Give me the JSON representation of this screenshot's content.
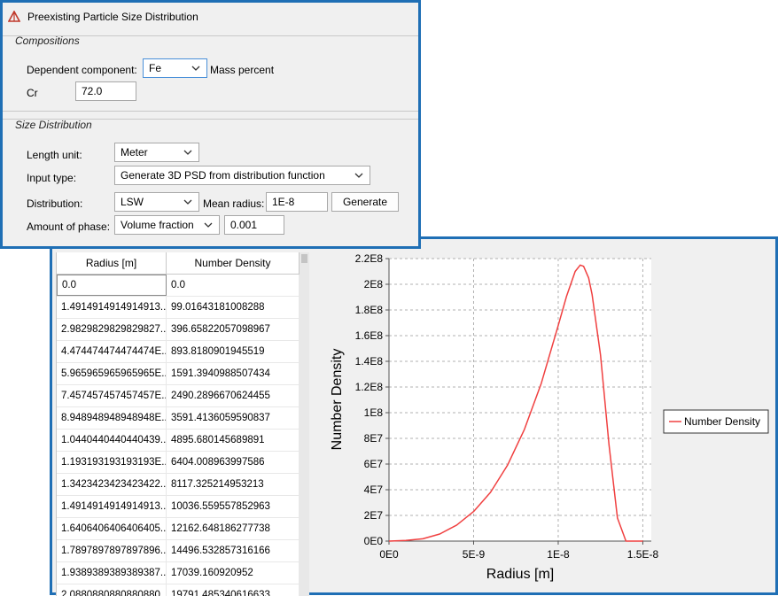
{
  "window": {
    "title": "Preexisting Particle Size Distribution"
  },
  "compositions": {
    "group_title": "Compositions",
    "dependent_label": "Dependent component:",
    "dependent_value": "Fe",
    "unit_label": "Mass percent",
    "cr_label": "Cr",
    "cr_value": "72.0"
  },
  "size_distribution": {
    "group_title": "Size Distribution",
    "length_unit_label": "Length unit:",
    "length_unit_value": "Meter",
    "input_type_label": "Input type:",
    "input_type_value": "Generate 3D PSD from distribution function",
    "distribution_label": "Distribution:",
    "distribution_value": "LSW",
    "mean_radius_label": "Mean radius:",
    "mean_radius_value": "1E-8",
    "generate_label": "Generate",
    "amount_label": "Amount of phase:",
    "amount_type_value": "Volume fraction",
    "amount_value": "0.001"
  },
  "table": {
    "headers": [
      "Radius [m]",
      "Number Density"
    ],
    "rows": [
      [
        "0.0",
        "0.0"
      ],
      [
        "1.4914914914914913...",
        "99.01643181008288"
      ],
      [
        "2.9829829829829827...",
        "396.65822057098967"
      ],
      [
        "4.474474474474474E...",
        "893.8180901945519"
      ],
      [
        "5.965965965965965E...",
        "1591.3940988507434"
      ],
      [
        "7.457457457457457E...",
        "2490.2896670624455"
      ],
      [
        "8.948948948948948E...",
        "3591.4136059590837"
      ],
      [
        "1.0440440440440439...",
        "4895.680145689891"
      ],
      [
        "1.193193193193193E...",
        "6404.008963997586"
      ],
      [
        "1.3423423423423422...",
        "8117.325214953213"
      ],
      [
        "1.4914914914914913...",
        "10036.559557852963"
      ],
      [
        "1.6406406406406405...",
        "12162.648186277738"
      ],
      [
        "1.7897897897897896...",
        "14496.532857316166"
      ],
      [
        "1.9389389389389387...",
        "17039.160920952"
      ],
      [
        "2.0880880880880880...",
        "19791.485340616633"
      ]
    ]
  },
  "chart_data": {
    "type": "line",
    "xlabel": "Radius [m]",
    "ylabel": "Number Density",
    "xlim": [
      0,
      1.55e-08
    ],
    "ylim": [
      0,
      220000000.0
    ],
    "x_ticks": [
      "0E0",
      "5E-9",
      "1E-8",
      "1.5E-8"
    ],
    "x_tick_values": [
      0,
      5e-09,
      1e-08,
      1.5e-08
    ],
    "y_ticks": [
      "0E0",
      "2E7",
      "4E7",
      "6E7",
      "8E7",
      "1E8",
      "1.2E8",
      "1.4E8",
      "1.6E8",
      "1.8E8",
      "2E8",
      "2.2E8"
    ],
    "y_tick_values": [
      0,
      20000000.0,
      40000000.0,
      60000000.0,
      80000000.0,
      100000000.0,
      120000000.0,
      140000000.0,
      160000000.0,
      180000000.0,
      200000000.0,
      220000000.0
    ],
    "grid": true,
    "legend_position": "right",
    "series": [
      {
        "name": "Number Density",
        "color": "#f04040",
        "x": [
          0,
          1e-09,
          2e-09,
          3e-09,
          4e-09,
          5e-09,
          6e-09,
          7e-09,
          8e-09,
          9e-09,
          1e-08,
          1.05e-08,
          1.1e-08,
          1.13e-08,
          1.15e-08,
          1.18e-08,
          1.2e-08,
          1.25e-08,
          1.3e-08,
          1.35e-08,
          1.4e-08,
          1.45e-08,
          1.5e-08
        ],
        "y": [
          0,
          450000.0,
          1800000.0,
          5500000.0,
          12500000.0,
          23000000.0,
          38000000.0,
          59000000.0,
          87000000.0,
          123000000.0,
          168000000.0,
          191000000.0,
          210000000.0,
          215000000.0,
          214000000.0,
          205000000.0,
          192000000.0,
          145000000.0,
          75000000.0,
          18000000.0,
          0,
          0,
          0
        ]
      }
    ]
  }
}
